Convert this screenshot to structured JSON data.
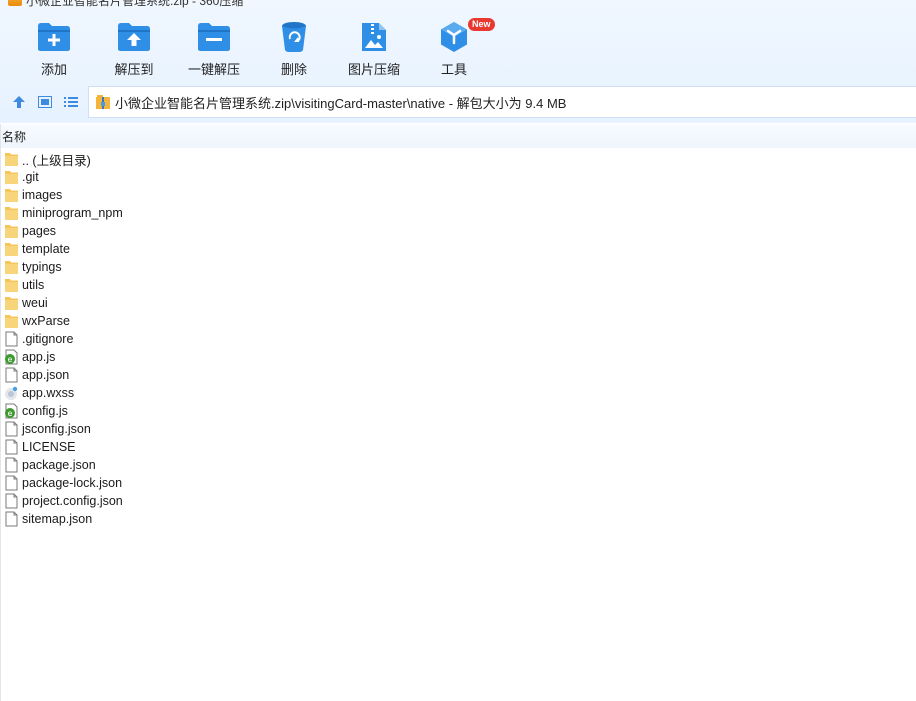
{
  "window": {
    "title": "小微企业智能名片管理系统.zip - 360压缩"
  },
  "toolbar": {
    "items": [
      {
        "label": "添加",
        "icon": "add-icon"
      },
      {
        "label": "解压到",
        "icon": "extract-to-icon"
      },
      {
        "label": "一键解压",
        "icon": "one-click-extract-icon"
      },
      {
        "label": "删除",
        "icon": "delete-icon"
      },
      {
        "label": "图片压缩",
        "icon": "image-compress-icon"
      },
      {
        "label": "工具",
        "icon": "tools-icon",
        "badge": "New"
      }
    ]
  },
  "address": {
    "path": "小微企业智能名片管理系统.zip\\visitingCard-master\\native - 解包大小为 9.4 MB"
  },
  "list": {
    "column_name": "名称",
    "items": [
      {
        "name": ".. (上级目录)",
        "type": "folder"
      },
      {
        "name": ".git",
        "type": "folder"
      },
      {
        "name": "images",
        "type": "folder"
      },
      {
        "name": "miniprogram_npm",
        "type": "folder"
      },
      {
        "name": "pages",
        "type": "folder"
      },
      {
        "name": "template",
        "type": "folder"
      },
      {
        "name": "typings",
        "type": "folder"
      },
      {
        "name": "utils",
        "type": "folder"
      },
      {
        "name": "weui",
        "type": "folder"
      },
      {
        "name": "wxParse",
        "type": "folder"
      },
      {
        "name": ".gitignore",
        "type": "file"
      },
      {
        "name": "app.js",
        "type": "js"
      },
      {
        "name": "app.json",
        "type": "file"
      },
      {
        "name": "app.wxss",
        "type": "wxss"
      },
      {
        "name": "config.js",
        "type": "js"
      },
      {
        "name": "jsconfig.json",
        "type": "file"
      },
      {
        "name": "LICENSE",
        "type": "file"
      },
      {
        "name": "package.json",
        "type": "file"
      },
      {
        "name": "package-lock.json",
        "type": "file"
      },
      {
        "name": "project.config.json",
        "type": "file"
      },
      {
        "name": "sitemap.json",
        "type": "file"
      }
    ]
  },
  "colors": {
    "accent": "#2f8ee5",
    "folder": "#f5c75a",
    "badge": "#e8382f"
  }
}
